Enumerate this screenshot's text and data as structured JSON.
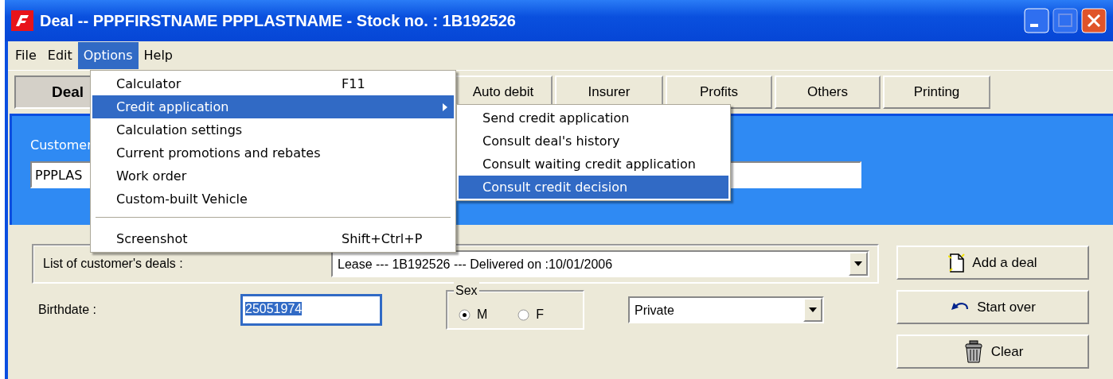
{
  "window": {
    "title": "Deal  --  PPPFIRSTNAME PPPLASTNAME - Stock no. : 1B192526"
  },
  "menu_bar": [
    {
      "label": "File",
      "selected": false
    },
    {
      "label": "Edit",
      "selected": false
    },
    {
      "label": "Options",
      "selected": true
    },
    {
      "label": "Help",
      "selected": false
    }
  ],
  "options_menu": [
    {
      "kind": "item",
      "label": "Calculator",
      "shortcut": "F11",
      "selected": false,
      "submenu": false
    },
    {
      "kind": "item",
      "label": "Credit application",
      "selected": true,
      "submenu": true
    },
    {
      "kind": "item",
      "label": "Calculation settings",
      "selected": false,
      "submenu": false
    },
    {
      "kind": "item",
      "label": "Current promotions and rebates",
      "selected": false,
      "submenu": false
    },
    {
      "kind": "item",
      "label": "Work order",
      "selected": false,
      "submenu": false
    },
    {
      "kind": "item",
      "label": "Custom-built Vehicle",
      "selected": false,
      "submenu": false
    },
    {
      "kind": "separator"
    },
    {
      "kind": "item",
      "label": "Screenshot",
      "shortcut": "Shift+Ctrl+P",
      "selected": false,
      "submenu": false
    }
  ],
  "credit_submenu": [
    {
      "label": "Send credit application",
      "selected": false
    },
    {
      "label": "Consult deal's history",
      "selected": false
    },
    {
      "label": "Consult waiting credit application",
      "selected": false
    },
    {
      "label": "Consult credit decision",
      "selected": true
    }
  ],
  "tabs": [
    {
      "label": "Deal",
      "selected": true
    },
    {
      "label": "Auto debit",
      "selected": false
    },
    {
      "label": "Insurer",
      "selected": false
    },
    {
      "label": "Profits",
      "selected": false
    },
    {
      "label": "Others",
      "selected": false
    },
    {
      "label": "Printing",
      "selected": false
    }
  ],
  "customer": {
    "label": "Customer",
    "name": "PPPLAS"
  },
  "deals": {
    "label": "List of customer's deals :",
    "value": "Lease --- 1B192526 --- Delivered on :10/01/2006"
  },
  "birthdate": {
    "label": "Birthdate :",
    "value": "25051974",
    "text_selected": true
  },
  "sex": {
    "label": "Sex",
    "options": [
      {
        "label": "M",
        "selected": true
      },
      {
        "label": "F",
        "selected": false
      }
    ]
  },
  "customer_type": {
    "value": "Private"
  },
  "buttons": [
    {
      "kind": "add",
      "label": "Add a deal"
    },
    {
      "kind": "undo",
      "label": "Start over"
    },
    {
      "kind": "clear",
      "label": "Clear"
    }
  ]
}
